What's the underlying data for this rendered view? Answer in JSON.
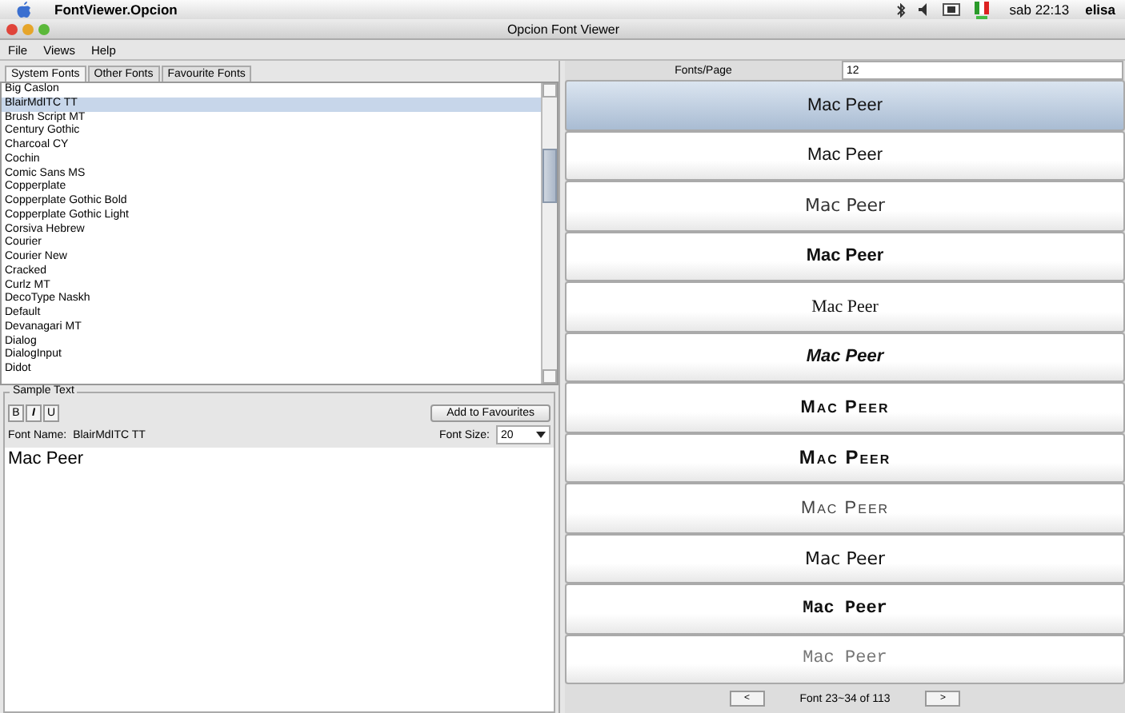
{
  "menu_bar": {
    "app_name": "FontViewer.Opcion",
    "clock": "sab 22:13",
    "user": "elisa"
  },
  "window": {
    "title": "Opcion Font Viewer"
  },
  "menus": [
    "File",
    "Views",
    "Help"
  ],
  "tabs": [
    {
      "label": "System Fonts",
      "selected": true
    },
    {
      "label": "Other Fonts",
      "selected": false
    },
    {
      "label": "Favourite Fonts",
      "selected": false
    }
  ],
  "font_list": [
    {
      "name": "Big Caslon",
      "selected": false
    },
    {
      "name": "BlairMdITC TT",
      "selected": true
    },
    {
      "name": "Brush Script MT",
      "selected": false
    },
    {
      "name": "Century Gothic",
      "selected": false
    },
    {
      "name": "Charcoal CY",
      "selected": false
    },
    {
      "name": "Cochin",
      "selected": false
    },
    {
      "name": "Comic Sans MS",
      "selected": false
    },
    {
      "name": "Copperplate",
      "selected": false
    },
    {
      "name": "Copperplate Gothic Bold",
      "selected": false
    },
    {
      "name": "Copperplate Gothic Light",
      "selected": false
    },
    {
      "name": "Corsiva Hebrew",
      "selected": false
    },
    {
      "name": "Courier",
      "selected": false
    },
    {
      "name": "Courier New",
      "selected": false
    },
    {
      "name": "Cracked",
      "selected": false
    },
    {
      "name": "Curlz MT",
      "selected": false
    },
    {
      "name": "DecoType Naskh",
      "selected": false
    },
    {
      "name": "Default",
      "selected": false
    },
    {
      "name": "Devanagari MT",
      "selected": false
    },
    {
      "name": "Dialog",
      "selected": false
    },
    {
      "name": "DialogInput",
      "selected": false
    },
    {
      "name": "Didot",
      "selected": false
    }
  ],
  "sample_text": {
    "legend": "Sample Text",
    "style_buttons": [
      "B",
      "I",
      "U"
    ],
    "add_button": "Add to Favourites",
    "font_name_label": "Font Name:",
    "font_name": "BlairMdITC TT",
    "font_size_label": "Font Size:",
    "font_size": "20",
    "text": "Mac Peer"
  },
  "preview": {
    "fonts_per_page_label": "Fonts/Page",
    "fonts_per_page": "12",
    "samples": [
      {
        "text": "Mac Peer",
        "kind": "sans",
        "selected": true
      },
      {
        "text": "Mac Peer",
        "kind": "sans",
        "selected": false
      },
      {
        "text": "Mac Peer",
        "kind": "light",
        "selected": false
      },
      {
        "text": "Mac Peer",
        "kind": "bold",
        "selected": false
      },
      {
        "text": "Mac Peer",
        "kind": "serif",
        "selected": false
      },
      {
        "text": "Mac Peer",
        "kind": "italic",
        "selected": false
      },
      {
        "text": "Mac Peer",
        "kind": "caps",
        "selected": false
      },
      {
        "text": "Mac Peer",
        "kind": "capsbig",
        "selected": false
      },
      {
        "text": "Mac Peer",
        "kind": "capslight",
        "selected": false
      },
      {
        "text": "Mac Peer",
        "kind": "semibold",
        "selected": false
      },
      {
        "text": "Mac Peer",
        "kind": "monobold",
        "selected": false
      },
      {
        "text": "Mac Peer",
        "kind": "mono",
        "selected": false
      }
    ],
    "prev_button": "<",
    "page_info": "Font 23~34 of 113",
    "next_button": ">"
  }
}
